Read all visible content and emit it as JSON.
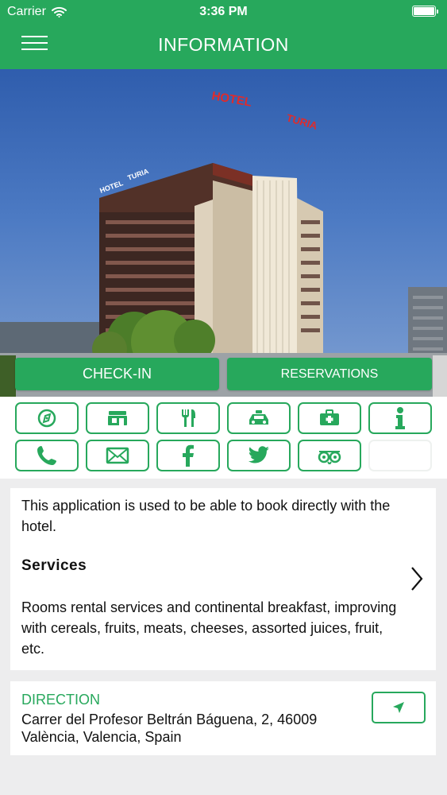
{
  "status_bar": {
    "carrier": "Carrier",
    "time": "3:36 PM"
  },
  "header": {
    "title": "INFORMATION"
  },
  "hero": {
    "image_label": "hotel-building-photo",
    "sign_top": "HOTEL",
    "sign_brand": "TURIA",
    "sign_left_hotel": "HOTEL",
    "sign_left_brand": "TURIA"
  },
  "actions": {
    "checkin": "CHECK-IN",
    "reservations": "RESERVATIONS"
  },
  "icons": [
    "compass-icon",
    "shop-icon",
    "cutlery-icon",
    "taxi-icon",
    "first-aid-icon",
    "info-icon",
    "phone-icon",
    "mail-icon",
    "facebook-icon",
    "twitter-icon",
    "tripadvisor-icon"
  ],
  "description": {
    "intro": "This application is used to be able to book directly with the hotel.",
    "services_title": "Services",
    "services_text": "Rooms rental services and continental breakfast, improving with cereals, fruits, meats, cheeses, assorted juices, fruit, etc."
  },
  "direction": {
    "label": "DIRECTION",
    "address_line1": "Carrer del Profesor Beltrán Báguena, 2, 46009",
    "address_line2": "València, Valencia, Spain"
  },
  "colors": {
    "accent": "#27a85c",
    "background": "#ededee",
    "card": "#ffffff"
  }
}
